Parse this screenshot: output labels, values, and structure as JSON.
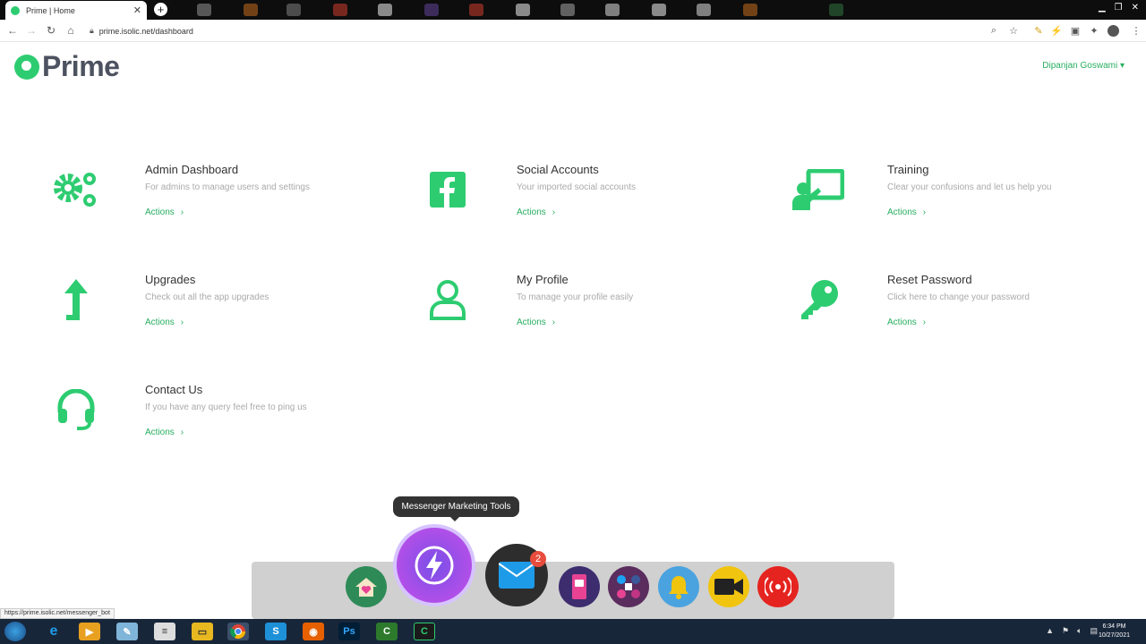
{
  "browser": {
    "tab_title": "Prime | Home",
    "url": "prime.isolic.net/dashboard",
    "status_url": "https://prime.isolic.net/messenger_bot"
  },
  "header": {
    "logo_text": "Prime",
    "user_name": "Dipanjan Goswami"
  },
  "cards": [
    {
      "title": "Admin Dashboard",
      "desc": "For admins to manage users and settings",
      "action": "Actions"
    },
    {
      "title": "Social Accounts",
      "desc": "Your imported social accounts",
      "action": "Actions"
    },
    {
      "title": "Training",
      "desc": "Clear your confusions and let us help you",
      "action": "Actions"
    },
    {
      "title": "Upgrades",
      "desc": "Check out all the app upgrades",
      "action": "Actions"
    },
    {
      "title": "My Profile",
      "desc": "To manage your profile easily",
      "action": "Actions"
    },
    {
      "title": "Reset Password",
      "desc": "Click here to change your password",
      "action": "Actions"
    },
    {
      "title": "Contact Us",
      "desc": "If you have any query feel free to ping us",
      "action": "Actions"
    }
  ],
  "dock": {
    "tooltip": "Messenger Marketing Tools",
    "badge_count": "2"
  },
  "taskbar": {
    "time": "6:34 PM",
    "date": "10/27/2021"
  },
  "colors": {
    "accent": "#2ecc71",
    "accent_dark": "#27ae60"
  }
}
